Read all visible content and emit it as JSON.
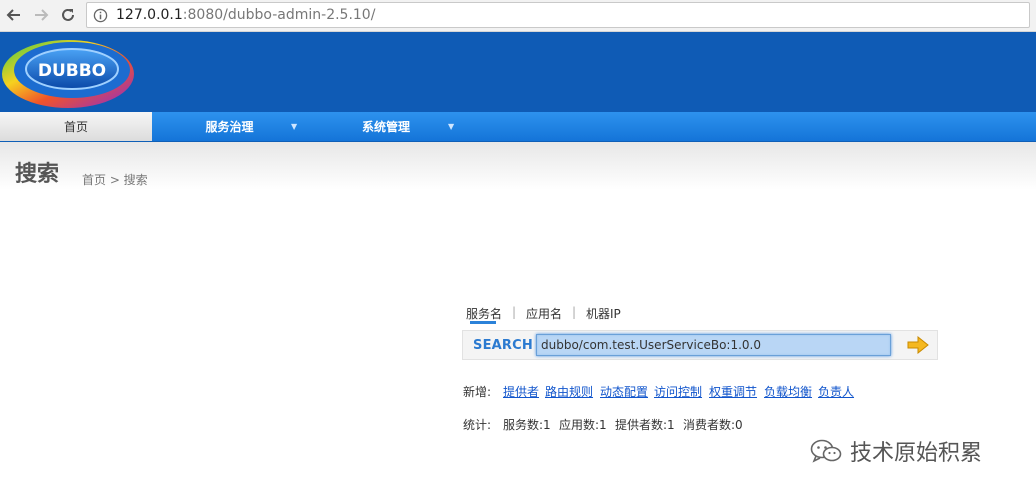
{
  "browser": {
    "url_host": "127.0.0.1",
    "url_rest": ":8080/dubbo-admin-2.5.10/"
  },
  "logo": {
    "text": "DUBBO"
  },
  "menu": {
    "items": [
      {
        "label": "首页"
      },
      {
        "label": "服务治理"
      },
      {
        "label": "系统管理"
      }
    ]
  },
  "page": {
    "title": "搜索",
    "breadcrumb": "首页 > 搜索"
  },
  "search": {
    "tabs": [
      {
        "label": "服务名"
      },
      {
        "label": "应用名"
      },
      {
        "label": "机器IP"
      }
    ],
    "label": "SEARCH",
    "value": "dubbo/com.test.UserServiceBo:1.0.0"
  },
  "add": {
    "label": "新增:",
    "links": [
      "提供者",
      "路由规则",
      "动态配置",
      "访问控制",
      "权重调节",
      "负载均衡",
      "负责人"
    ]
  },
  "stats": {
    "label": "统计:",
    "items": [
      "服务数:1",
      "应用数:1",
      "提供者数:1",
      "消费者数:0"
    ]
  },
  "watermark": {
    "text": "技术原始积累"
  },
  "colors": {
    "header": "#0f5bb5",
    "menu": "#1a7fe0",
    "link": "#1155cc",
    "search_label": "#2b7ad0",
    "arrow": "#f5b820"
  }
}
